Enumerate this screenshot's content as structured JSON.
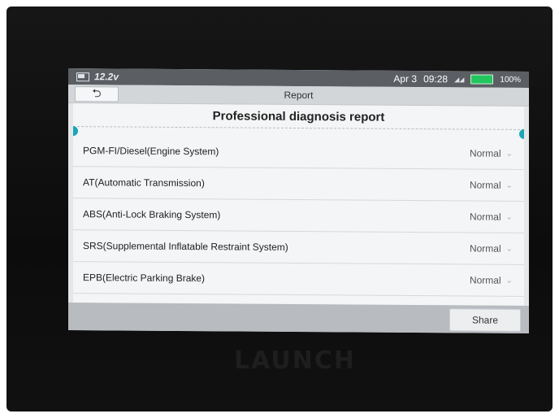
{
  "status_bar": {
    "voltage": "12.2v",
    "date": "Apr 3",
    "time": "09:28",
    "battery_percent": "100%",
    "battery_level": 1.0,
    "battery_color": "#22c55e"
  },
  "title_bar": {
    "back_icon": "back-arrow-icon",
    "back_glyph": "⮌",
    "title": "Report"
  },
  "report": {
    "heading": "Professional diagnosis report",
    "rows": [
      {
        "label": "PGM-FI/Diesel(Engine System)",
        "status": "Normal"
      },
      {
        "label": "AT(Automatic Transmission)",
        "status": "Normal"
      },
      {
        "label": "ABS(Anti-Lock Braking System)",
        "status": "Normal"
      },
      {
        "label": "SRS(Supplemental Inflatable Restraint System)",
        "status": "Normal"
      },
      {
        "label": "EPB(Electric Parking Brake)",
        "status": "Normal"
      }
    ],
    "chevron_glyph": "⌄"
  },
  "footer": {
    "share_label": "Share"
  },
  "device": {
    "brand": "LAUNCH"
  },
  "colors": {
    "accent": "#1aa6b7",
    "status_bar_bg": "#5b5e63"
  }
}
